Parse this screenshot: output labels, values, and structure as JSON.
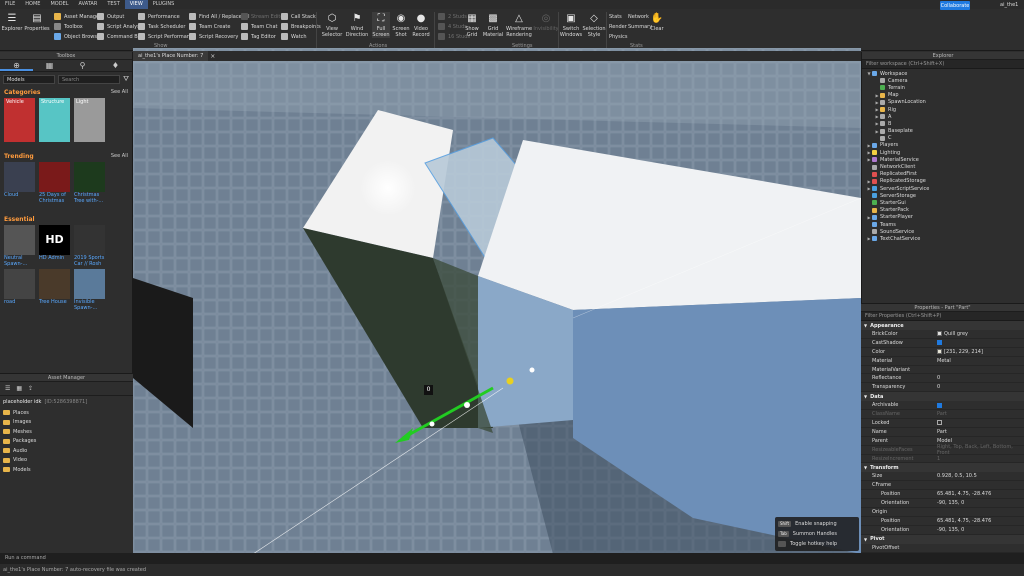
{
  "menubar": {
    "items": [
      "FILE",
      "HOME",
      "MODEL",
      "AVATAR",
      "TEST",
      "VIEW",
      "PLUGINS"
    ],
    "active": "VIEW"
  },
  "ribbon": {
    "explorer": "Explorer",
    "properties": "Properties",
    "show_col1": [
      "Asset Manager",
      "Toolbox",
      "Object Browser"
    ],
    "show_col2": [
      "Output",
      "Script Analysis",
      "Command Bar"
    ],
    "show_col3": [
      "Performance",
      "Task Scheduler",
      "Script Performance"
    ],
    "show_col4": [
      "Find All / Replace All",
      "Team Create",
      "Script Recovery"
    ],
    "show_col5": [
      "Stream Editor",
      "Team Chat",
      "Tag Editor"
    ],
    "show_col6": [
      "Call Stack",
      "Breakpoints",
      "Watch"
    ],
    "show_label": "Show",
    "actions": [
      "View Selector",
      "Wind Direction",
      "Full Screen",
      "Screen Shot",
      "Video Record"
    ],
    "actions_label": "Actions",
    "studs": [
      "2 Studs",
      "4 Studs",
      "16 Studs"
    ],
    "settings": [
      "Show Grid",
      "Grid Material",
      "Wireframe Rendering",
      "Invisibility"
    ],
    "settings_label": "Settings",
    "windows": [
      "Switch Windows",
      "Selection Style"
    ],
    "stats": [
      "Stats",
      "Network",
      "Render",
      "Summary",
      "Physics",
      "Clear"
    ],
    "stats_label": "Stats",
    "collaborate": "Collaborate",
    "user": "ai_the1"
  },
  "toolbox": {
    "title": "Toolbox",
    "category_select": "Models",
    "search_placeholder": "Search",
    "categories_title": "Categories",
    "see_all": "See All",
    "categories": [
      {
        "label": "Vehicle",
        "color": "#c03030"
      },
      {
        "label": "Structure",
        "color": "#57c5c5"
      },
      {
        "label": "Light",
        "color": "#9a9a9a"
      }
    ],
    "trending_title": "Trending",
    "trending": [
      "Cloud",
      "25 Days of Christmas",
      "Christmas Tree with-..."
    ],
    "essential_title": "Essential",
    "essential": [
      "Neutral Spawn-...",
      "HD Admin",
      "2019 Sports Car // Rosh",
      "road",
      "Tree House",
      "Invisible Spawn-..."
    ],
    "hd_logo": "HD"
  },
  "asset_manager": {
    "title": "Asset Manager",
    "place": "placeholder idk",
    "place_id": "[ID:5286398871]",
    "folders": [
      "Places",
      "Images",
      "Meshes",
      "Packages",
      "Audio",
      "Video",
      "Models"
    ]
  },
  "viewport": {
    "tab": "ai_the1's Place Number: 7",
    "badge": "0",
    "hotkeys": [
      {
        "key": "Shift",
        "label": "Enable snapping"
      },
      {
        "key": "Tab",
        "label": "Summon Handles"
      },
      {
        "key": "",
        "label": "Toggle hotkey help"
      }
    ]
  },
  "explorer": {
    "title": "Explorer",
    "filter": "Filter workspace (Ctrl+Shift+X)",
    "items": [
      {
        "label": "Workspace",
        "d": 0,
        "exp": true,
        "c": "#6aa8e8"
      },
      {
        "label": "Camera",
        "d": 1,
        "c": "#aaa"
      },
      {
        "label": "Terrain",
        "d": 1,
        "c": "#4caf50"
      },
      {
        "label": "Map",
        "d": 1,
        "exp": false,
        "c": "#e8b54a"
      },
      {
        "label": "SpawnLocation",
        "d": 1,
        "exp": false,
        "c": "#aaa"
      },
      {
        "label": "Rig",
        "d": 1,
        "exp": false,
        "c": "#e8b54a"
      },
      {
        "label": "A",
        "d": 1,
        "exp": false,
        "c": "#aaa"
      },
      {
        "label": "B",
        "d": 1,
        "exp": false,
        "c": "#aaa"
      },
      {
        "label": "Baseplate",
        "d": 1,
        "exp": false,
        "c": "#aaa"
      },
      {
        "label": "C",
        "d": 1,
        "c": "#aaa"
      },
      {
        "label": "Players",
        "d": 0,
        "exp": false,
        "c": "#6aa8e8"
      },
      {
        "label": "Lighting",
        "d": 0,
        "exp": false,
        "c": "#f5d142"
      },
      {
        "label": "MaterialService",
        "d": 0,
        "exp": false,
        "c": "#b07ad0"
      },
      {
        "label": "NetworkClient",
        "d": 0,
        "c": "#aaa"
      },
      {
        "label": "ReplicatedFirst",
        "d": 0,
        "c": "#e05050"
      },
      {
        "label": "ReplicatedStorage",
        "d": 0,
        "exp": false,
        "c": "#e05050"
      },
      {
        "label": "ServerScriptService",
        "d": 0,
        "exp": false,
        "c": "#4aa0e0"
      },
      {
        "label": "ServerStorage",
        "d": 0,
        "c": "#4aa0e0"
      },
      {
        "label": "StarterGui",
        "d": 0,
        "c": "#4caf50"
      },
      {
        "label": "StarterPack",
        "d": 0,
        "c": "#e8b54a"
      },
      {
        "label": "StarterPlayer",
        "d": 0,
        "exp": false,
        "c": "#6aa8e8"
      },
      {
        "label": "Teams",
        "d": 0,
        "c": "#6aa8e8"
      },
      {
        "label": "SoundService",
        "d": 0,
        "c": "#aaa"
      },
      {
        "label": "TextChatService",
        "d": 0,
        "exp": false,
        "c": "#6aa8e8"
      }
    ]
  },
  "properties": {
    "title": "Properties - Part \"Part\"",
    "filter": "Filter Properties (Ctrl+Shift+P)",
    "sections": [
      {
        "name": "Appearance",
        "rows": [
          {
            "k": "BrickColor",
            "v": "Quill grey",
            "sw": "#dfdfde"
          },
          {
            "k": "CastShadow",
            "chk": true
          },
          {
            "k": "Color",
            "v": "[231, 229, 214]",
            "sw": "#e7e5d6"
          },
          {
            "k": "Material",
            "v": "Metal"
          },
          {
            "k": "MaterialVariant",
            "v": ""
          },
          {
            "k": "Reflectance",
            "v": "0"
          },
          {
            "k": "Transparency",
            "v": "0"
          }
        ]
      },
      {
        "name": "Data",
        "rows": [
          {
            "k": "Archivable",
            "chk": true
          },
          {
            "k": "ClassName",
            "v": "Part",
            "dim": true
          },
          {
            "k": "Locked",
            "chk": false
          },
          {
            "k": "Name",
            "v": "Part"
          },
          {
            "k": "Parent",
            "v": "Model"
          },
          {
            "k": "ResizeableFaces",
            "v": "Right, Top, Back, Left, Bottom, Front",
            "dim": true
          },
          {
            "k": "ResizeIncrement",
            "v": "1",
            "dim": true
          }
        ]
      },
      {
        "name": "Transform",
        "rows": [
          {
            "k": "Size",
            "v": "0.928, 0.5, 10.5"
          },
          {
            "k": "CFrame",
            "v": ""
          },
          {
            "k": "Position",
            "v": "65.481, 4.75, -28.476",
            "ind": true
          },
          {
            "k": "Orientation",
            "v": "-90, 135, 0",
            "ind": true
          },
          {
            "k": "Origin",
            "v": ""
          },
          {
            "k": "Position",
            "v": "65.481, 4.75, -28.476",
            "ind": true
          },
          {
            "k": "Orientation",
            "v": "-90, 135, 0",
            "ind": true
          }
        ]
      },
      {
        "name": "Pivot",
        "rows": [
          {
            "k": "PivotOffset",
            "v": ""
          }
        ]
      }
    ]
  },
  "command": {
    "placeholder": "Run a command"
  },
  "status": {
    "text": "ai_the1's Place Number: 7 auto-recovery file was created"
  }
}
